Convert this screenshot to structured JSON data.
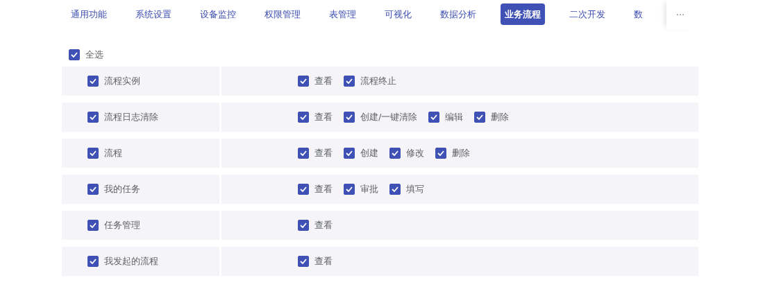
{
  "tabs": [
    {
      "label": "通用功能",
      "selected": false
    },
    {
      "label": "系统设置",
      "selected": false
    },
    {
      "label": "设备监控",
      "selected": false
    },
    {
      "label": "权限管理",
      "selected": false
    },
    {
      "label": "表管理",
      "selected": false
    },
    {
      "label": "可视化",
      "selected": false
    },
    {
      "label": "数据分析",
      "selected": false
    },
    {
      "label": "业务流程",
      "selected": true
    },
    {
      "label": "二次开发",
      "selected": false
    },
    {
      "label": "数",
      "selected": false
    }
  ],
  "tabs_more": "···",
  "select_all": {
    "label": "全选",
    "checked": true
  },
  "groups": [
    {
      "name": "流程实例",
      "checked": true,
      "permissions": [
        {
          "label": "查看",
          "checked": true
        },
        {
          "label": "流程终止",
          "checked": true
        }
      ]
    },
    {
      "name": "流程日志清除",
      "checked": true,
      "permissions": [
        {
          "label": "查看",
          "checked": true
        },
        {
          "label": "创建/一键清除",
          "checked": true
        },
        {
          "label": "编辑",
          "checked": true
        },
        {
          "label": "删除",
          "checked": true
        }
      ]
    },
    {
      "name": "流程",
      "checked": true,
      "permissions": [
        {
          "label": "查看",
          "checked": true
        },
        {
          "label": "创建",
          "checked": true
        },
        {
          "label": "修改",
          "checked": true
        },
        {
          "label": "删除",
          "checked": true
        }
      ]
    },
    {
      "name": "我的任务",
      "checked": true,
      "permissions": [
        {
          "label": "查看",
          "checked": true
        },
        {
          "label": "审批",
          "checked": true
        },
        {
          "label": "填写",
          "checked": true
        }
      ]
    },
    {
      "name": "任务管理",
      "checked": true,
      "permissions": [
        {
          "label": "查看",
          "checked": true
        }
      ]
    },
    {
      "name": "我发起的流程",
      "checked": true,
      "permissions": [
        {
          "label": "查看",
          "checked": true
        }
      ]
    }
  ]
}
